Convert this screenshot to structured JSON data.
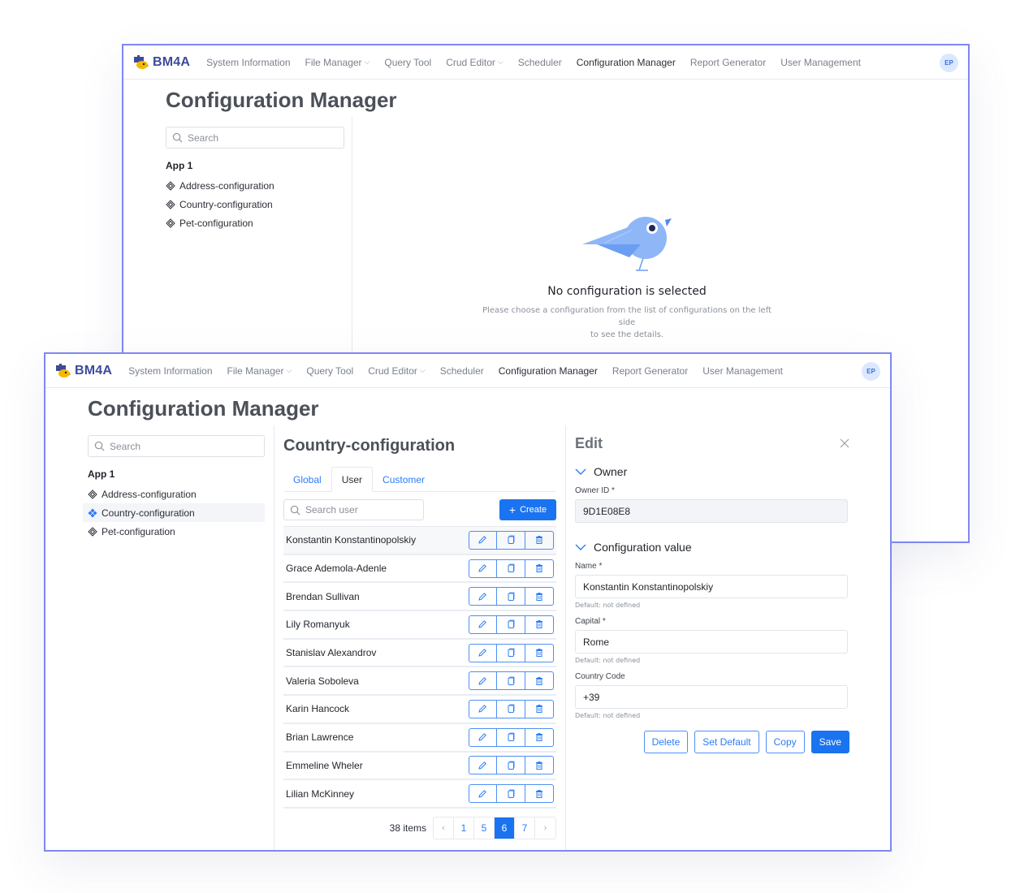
{
  "nav": {
    "brand": "BM4A",
    "items": [
      {
        "label": "System Information",
        "dropdown": false
      },
      {
        "label": "File Manager",
        "dropdown": true
      },
      {
        "label": "Query Tool",
        "dropdown": false
      },
      {
        "label": "Crud Editor",
        "dropdown": true
      },
      {
        "label": "Scheduler",
        "dropdown": false
      },
      {
        "label": "Configuration Manager",
        "dropdown": false,
        "active": true
      },
      {
        "label": "Report Generator",
        "dropdown": false
      },
      {
        "label": "User Management",
        "dropdown": false
      }
    ],
    "chevron": "⌵",
    "avatar_initials": "EP"
  },
  "page_title": "Configuration Manager",
  "sidebar": {
    "search_placeholder": "Search",
    "group": "App 1",
    "items": [
      {
        "label": "Address-configuration"
      },
      {
        "label": "Country-configuration"
      },
      {
        "label": "Pet-configuration"
      }
    ],
    "selected_index_front": 1
  },
  "empty_state": {
    "title": "No configuration is selected",
    "description_line1": "Please choose a configuration from the list of configurations on the left side",
    "description_line2": "to see the details."
  },
  "main": {
    "title": "Country-configuration",
    "tabs": [
      {
        "label": "Global"
      },
      {
        "label": "User",
        "active": true
      },
      {
        "label": "Customer"
      }
    ],
    "search_placeholder": "Search user",
    "create_label": "Create",
    "create_icon": "+",
    "rows": [
      {
        "name": "Konstantin Konstantinopolskiy"
      },
      {
        "name": "Grace Ademola-Adenle"
      },
      {
        "name": "Brendan Sullivan"
      },
      {
        "name": "Lily Romanyuk"
      },
      {
        "name": "Stanislav Alexandrov"
      },
      {
        "name": "Valeria Soboleva"
      },
      {
        "name": "Karin Hancock"
      },
      {
        "name": "Brian Lawrence"
      },
      {
        "name": "Emmeline Wheler"
      },
      {
        "name": "Lilian McKinney"
      }
    ],
    "pagination": {
      "total": "38 items",
      "prev": "‹",
      "next": "›",
      "pages": [
        "1",
        "5",
        "6",
        "7"
      ],
      "current": "6"
    }
  },
  "edit": {
    "title": "Edit",
    "owner_section": "Owner",
    "owner_id_label": "Owner ID *",
    "owner_id_value": "9D1E08E8",
    "config_section": "Configuration value",
    "fields": [
      {
        "label": "Name *",
        "value": "Konstantin Konstantinopolskiy",
        "hint": "Default: not defined"
      },
      {
        "label": "Capital *",
        "value": "Rome",
        "hint": "Default: not defined"
      },
      {
        "label": "Country Code",
        "value": "+39",
        "hint": "Default: not defined"
      }
    ],
    "buttons": {
      "delete": "Delete",
      "set_default": "Set Default",
      "copy": "Copy",
      "save": "Save"
    }
  },
  "colors": {
    "accent": "#1a73f0",
    "window_border": "#8087f2",
    "brand": "#3d4a9a"
  }
}
